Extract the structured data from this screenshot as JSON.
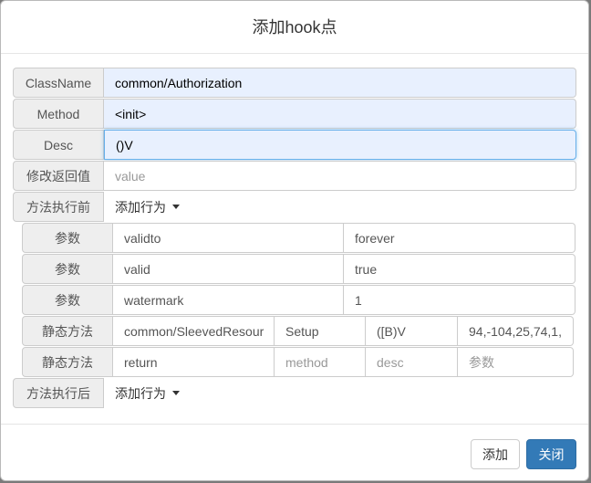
{
  "modal": {
    "title": "添加hook点"
  },
  "fields": {
    "classname": {
      "label": "ClassName",
      "value": "common/Authorization"
    },
    "method": {
      "label": "Method",
      "value": "<init>"
    },
    "desc": {
      "label": "Desc",
      "value": "()V"
    },
    "return_value": {
      "label": "修改返回值",
      "placeholder": "value"
    }
  },
  "before": {
    "label": "方法执行前",
    "action": "添加行为",
    "params": [
      {
        "label": "参数",
        "name": "validto",
        "value": "forever"
      },
      {
        "label": "参数",
        "name": "valid",
        "value": "true"
      },
      {
        "label": "参数",
        "name": "watermark",
        "value": "1"
      }
    ],
    "static_methods": [
      {
        "label": "静态方法",
        "class": "common/SleevedResour",
        "method": "Setup",
        "desc": "([B)V",
        "args": "94,-104,25,74,1,"
      },
      {
        "label": "静态方法",
        "class": "return",
        "method_placeholder": "method",
        "desc_placeholder": "desc",
        "args_placeholder": "参数"
      }
    ]
  },
  "after": {
    "label": "方法执行后",
    "action": "添加行为"
  },
  "footer": {
    "add": "添加",
    "close": "关闭"
  }
}
